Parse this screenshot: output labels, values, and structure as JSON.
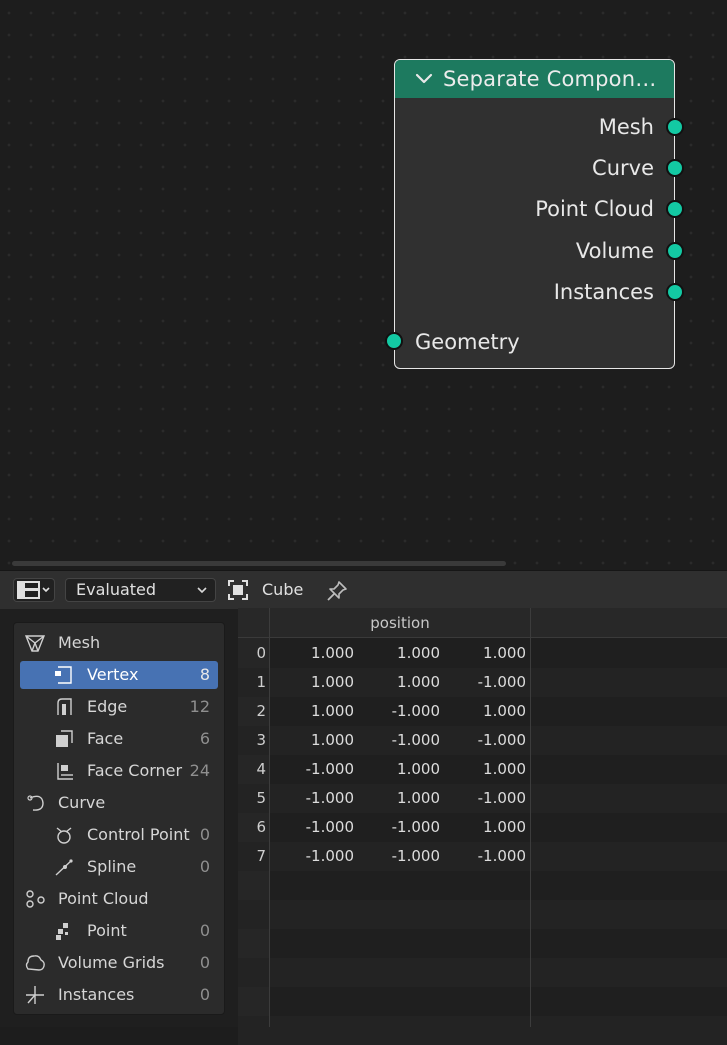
{
  "node": {
    "title": "Separate Compon…",
    "header_color": "#1d7a5f",
    "socket_color": "#13c9a3",
    "outputs": [
      "Mesh",
      "Curve",
      "Point Cloud",
      "Volume",
      "Instances"
    ],
    "input": "Geometry"
  },
  "spreadsheet": {
    "evaluation_mode": "Evaluated",
    "object_name": "Cube",
    "tree": [
      {
        "label": "Mesh",
        "count": "",
        "level": 0,
        "icon": "mesh-icon"
      },
      {
        "label": "Vertex",
        "count": "8",
        "level": 1,
        "icon": "vertex-icon",
        "selected": true
      },
      {
        "label": "Edge",
        "count": "12",
        "level": 1,
        "icon": "edge-icon"
      },
      {
        "label": "Face",
        "count": "6",
        "level": 1,
        "icon": "face-icon"
      },
      {
        "label": "Face Corner",
        "count": "24",
        "level": 1,
        "icon": "face-corner-icon"
      },
      {
        "label": "Curve",
        "count": "",
        "level": 0,
        "icon": "curve-icon"
      },
      {
        "label": "Control Point",
        "count": "0",
        "level": 1,
        "icon": "control-point-icon"
      },
      {
        "label": "Spline",
        "count": "0",
        "level": 1,
        "icon": "spline-icon"
      },
      {
        "label": "Point Cloud",
        "count": "",
        "level": 0,
        "icon": "point-cloud-icon"
      },
      {
        "label": "Point",
        "count": "0",
        "level": 1,
        "icon": "point-icon"
      },
      {
        "label": "Volume Grids",
        "count": "0",
        "level": 0,
        "icon": "volume-icon"
      },
      {
        "label": "Instances",
        "count": "0",
        "level": 0,
        "icon": "instances-icon"
      }
    ],
    "selected_color": "#4772b3",
    "column_header": "position",
    "rows": [
      {
        "index": "0",
        "values": [
          "1.000",
          "1.000",
          "1.000"
        ]
      },
      {
        "index": "1",
        "values": [
          "1.000",
          "1.000",
          "-1.000"
        ]
      },
      {
        "index": "2",
        "values": [
          "1.000",
          "-1.000",
          "1.000"
        ]
      },
      {
        "index": "3",
        "values": [
          "1.000",
          "-1.000",
          "-1.000"
        ]
      },
      {
        "index": "4",
        "values": [
          "-1.000",
          "1.000",
          "1.000"
        ]
      },
      {
        "index": "5",
        "values": [
          "-1.000",
          "1.000",
          "-1.000"
        ]
      },
      {
        "index": "6",
        "values": [
          "-1.000",
          "-1.000",
          "1.000"
        ]
      },
      {
        "index": "7",
        "values": [
          "-1.000",
          "-1.000",
          "-1.000"
        ]
      }
    ]
  }
}
